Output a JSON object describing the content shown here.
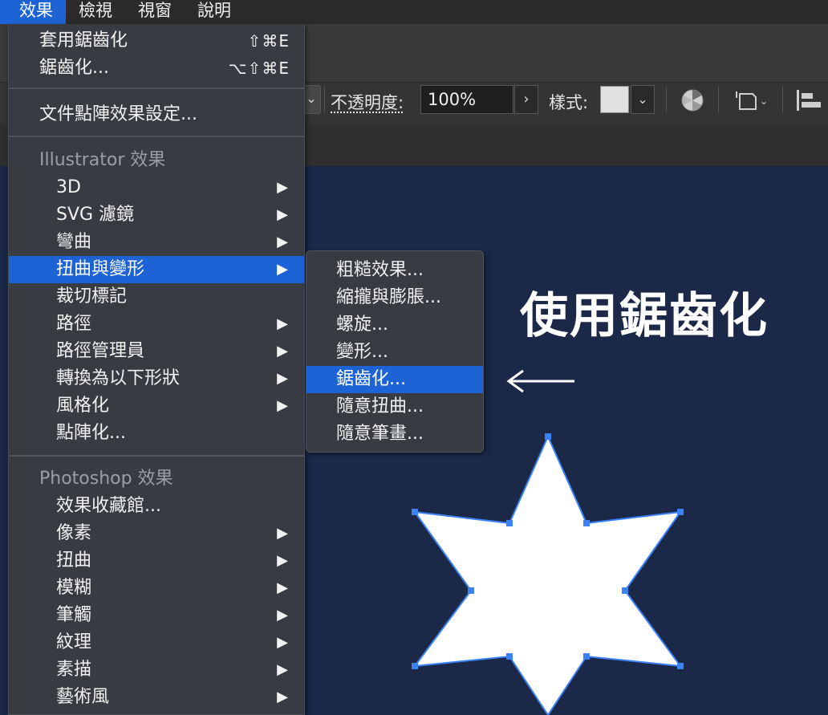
{
  "menubar": {
    "items": [
      "效果",
      "檢視",
      "視窗",
      "說明"
    ]
  },
  "control_bar": {
    "opacity_label": "不透明度:",
    "opacity_value": "100%",
    "opacity_arrow": "›",
    "style_label": "樣式:",
    "dropdown_glyph": "⌄"
  },
  "effect_menu": {
    "apply_last": {
      "label": "套用鋸齒化",
      "shortcut": "⇧⌘E"
    },
    "last_effect": {
      "label": "鋸齒化...",
      "shortcut": "⌥⇧⌘E"
    },
    "raster_settings": "文件點陣效果設定...",
    "illustrator_header": "Illustrator 效果",
    "illustrator_items": [
      {
        "label": "3D",
        "submenu": true
      },
      {
        "label": "SVG 濾鏡",
        "submenu": true
      },
      {
        "label": "彎曲",
        "submenu": true
      },
      {
        "label": "扭曲與變形",
        "submenu": true,
        "selected": true
      },
      {
        "label": "裁切標記",
        "submenu": false
      },
      {
        "label": "路徑",
        "submenu": true
      },
      {
        "label": "路徑管理員",
        "submenu": true
      },
      {
        "label": "轉換為以下形狀",
        "submenu": true
      },
      {
        "label": "風格化",
        "submenu": true
      },
      {
        "label": "點陣化...",
        "submenu": false
      }
    ],
    "photoshop_header": "Photoshop 效果",
    "photoshop_items": [
      {
        "label": "效果收藏館...",
        "submenu": false
      },
      {
        "label": "像素",
        "submenu": true
      },
      {
        "label": "扭曲",
        "submenu": true
      },
      {
        "label": "模糊",
        "submenu": true
      },
      {
        "label": "筆觸",
        "submenu": true
      },
      {
        "label": "紋理",
        "submenu": true
      },
      {
        "label": "素描",
        "submenu": true
      },
      {
        "label": "藝術風",
        "submenu": true
      }
    ],
    "arrow_glyph": "▶"
  },
  "distort_submenu": {
    "items": [
      {
        "label": "粗糙效果..."
      },
      {
        "label": "縮攏與膨脹..."
      },
      {
        "label": "螺旋..."
      },
      {
        "label": "變形..."
      },
      {
        "label": "鋸齒化...",
        "selected": true
      },
      {
        "label": "隨意扭曲..."
      },
      {
        "label": "隨意筆畫..."
      }
    ]
  },
  "annotation": {
    "text": "使用鋸齒化",
    "arrow_icon": "left-arrow-icon"
  },
  "colors": {
    "canvas_bg": "#1b2847",
    "selection": "#1d63d6",
    "menu_bg": "#383c42",
    "star_fill": "#ffffff",
    "anchor_color": "#3b82f6"
  }
}
